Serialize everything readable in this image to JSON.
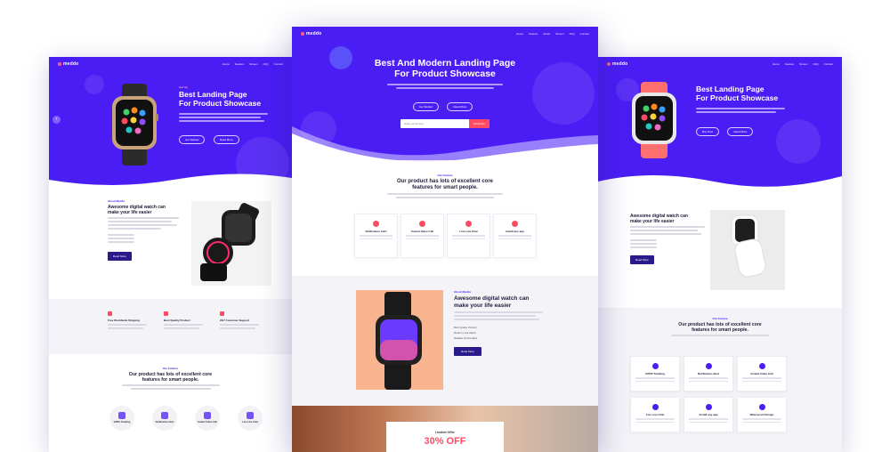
{
  "left": {
    "logo": "meddo",
    "nav": [
      "Home",
      "Feature",
      "Screen",
      "FAQ",
      "Contact"
    ],
    "hero": {
      "kicker": "Get Up",
      "title_line1": "Best Landing Page",
      "title_line2": "For Product Showcase",
      "btn1": "Get Started",
      "btn2": "Read More"
    },
    "about": {
      "kicker": "About Meddo",
      "title_line1": "Awesome digital watch can",
      "title_line2": "make your life easier",
      "button": "Read More"
    },
    "features": [
      {
        "label": "Free Worldwide Shipping"
      },
      {
        "label": "Best Quality Product"
      },
      {
        "label": "24/7 Customer Support"
      }
    ],
    "section": {
      "kicker": "Our Feature",
      "title_line1": "Our product has lots of excellent core",
      "title_line2": "features for smart people."
    },
    "icons": [
      "GPRS Tracking",
      "Notification Alert",
      "Instant Video Call",
      "Live Live Chat"
    ]
  },
  "center": {
    "logo": "meddo",
    "nav": [
      "Home",
      "Feature",
      "About",
      "Screen",
      "FAQ",
      "Contact"
    ],
    "hero": {
      "title_line1": "Best And Modern Landing Page",
      "title_line2": "For Product Showcase",
      "btn1": "Get Started",
      "btn2": "Read More",
      "email_placeholder": "Enter email here",
      "subscribe": "Subscribe"
    },
    "section": {
      "kicker": "Our Feature",
      "title_line1": "Our product has lots of excellent core",
      "title_line2": "features for smart people."
    },
    "cards": [
      "Notification Alert",
      "Instant Video Call",
      "Live Live Chat",
      "Install any app"
    ],
    "about": {
      "kicker": "About Meddo",
      "title_line1": "Awesome digital watch can",
      "title_line2": "make your life easier",
      "list": [
        "Best Quality Product",
        "Modern Look Watch",
        "Reliable and Durable"
      ],
      "button": "Read More"
    },
    "offer": {
      "label": "Limited Offer",
      "value": "30% OFF"
    }
  },
  "right": {
    "logo": "meddo",
    "nav": [
      "Home",
      "Feature",
      "Screen",
      "FAQ",
      "Contact"
    ],
    "hero": {
      "title_line1": "Best Landing Page",
      "title_line2": "For Product Showcase",
      "btn1": "Buy Now",
      "btn2": "Read More"
    },
    "about": {
      "title_line1": "Awesome digital watch can",
      "title_line2": "make your life easier",
      "button": "Read More"
    },
    "section": {
      "kicker": "Our Feature",
      "title_line1": "Our product has lots of excellent core",
      "title_line2": "features for smart people."
    },
    "cards": [
      "GPRS Tracking",
      "Notification Alert",
      "Instant Video Call",
      "Live Live Chat",
      "Install any app",
      "Waterproof Design"
    ]
  },
  "colors": {
    "brand": "#4a1df5",
    "accent": "#ff4a63",
    "dark": "#2a1a8c",
    "peach": "#f7b48f"
  }
}
